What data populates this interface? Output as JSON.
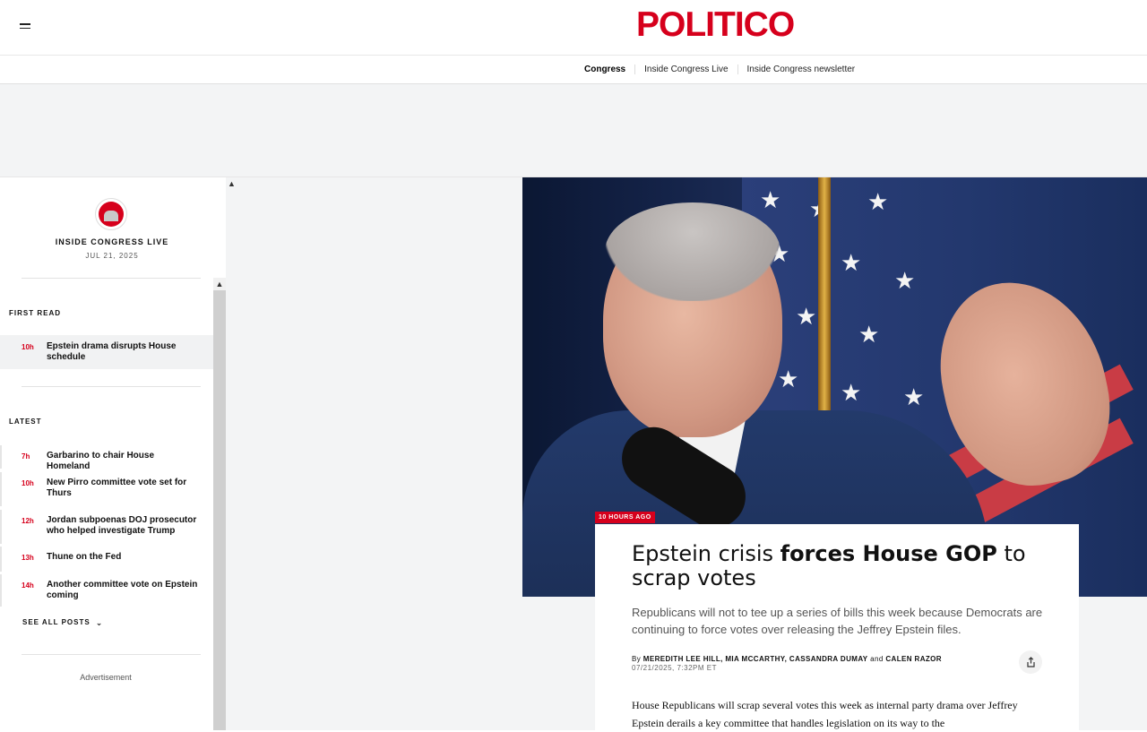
{
  "header": {
    "logo": "POLITICO",
    "menu_icon": "hamburger-menu-icon"
  },
  "subnav": {
    "items": [
      "Congress",
      "Inside Congress Live",
      "Inside Congress newsletter"
    ]
  },
  "sidebar": {
    "live_title": "INSIDE CONGRESS LIVE",
    "live_date": "JUL 21, 2025",
    "first_read_label": "FIRST READ",
    "first_read": [
      {
        "age": "10h",
        "headline": "Epstein drama disrupts House schedule"
      }
    ],
    "latest_label": "LATEST",
    "latest": [
      {
        "age": "7h",
        "headline": "Garbarino to chair House Homeland"
      },
      {
        "age": "10h",
        "headline": "New Pirro committee vote set for Thurs"
      },
      {
        "age": "12h",
        "headline": "Jordan subpoenas DOJ prosecutor who helped investigate Trump"
      },
      {
        "age": "13h",
        "headline": "Thune on the Fed"
      },
      {
        "age": "14h",
        "headline": "Another committee vote on Epstein coming"
      }
    ],
    "see_all": "SEE ALL POSTS",
    "advertisement": "Advertisement"
  },
  "article": {
    "time_tag": "10 HOURS AGO",
    "headline_pre": "Epstein crisis ",
    "headline_bold": "forces House GOP",
    "headline_post": " to scrap votes",
    "dek": "Republicans will not to tee up a series of bills this week because Democrats are continuing to force votes over releasing the Jeffrey Epstein files.",
    "byline_prefix": "By",
    "authors_1": "MEREDITH LEE HILL, MIA MCCARTHY, CASSANDRA DUMAY",
    "and": "and",
    "authors_2": "CALEN RAZOR",
    "dateline": "07/21/2025, 7:32PM ET",
    "body": "House Republicans will scrap several votes this week as internal party drama over Jeffrey Epstein derails a key committee that handles legislation on its way to the"
  },
  "colors": {
    "brand_red": "#d6001c",
    "page_bg": "#f3f4f5"
  }
}
